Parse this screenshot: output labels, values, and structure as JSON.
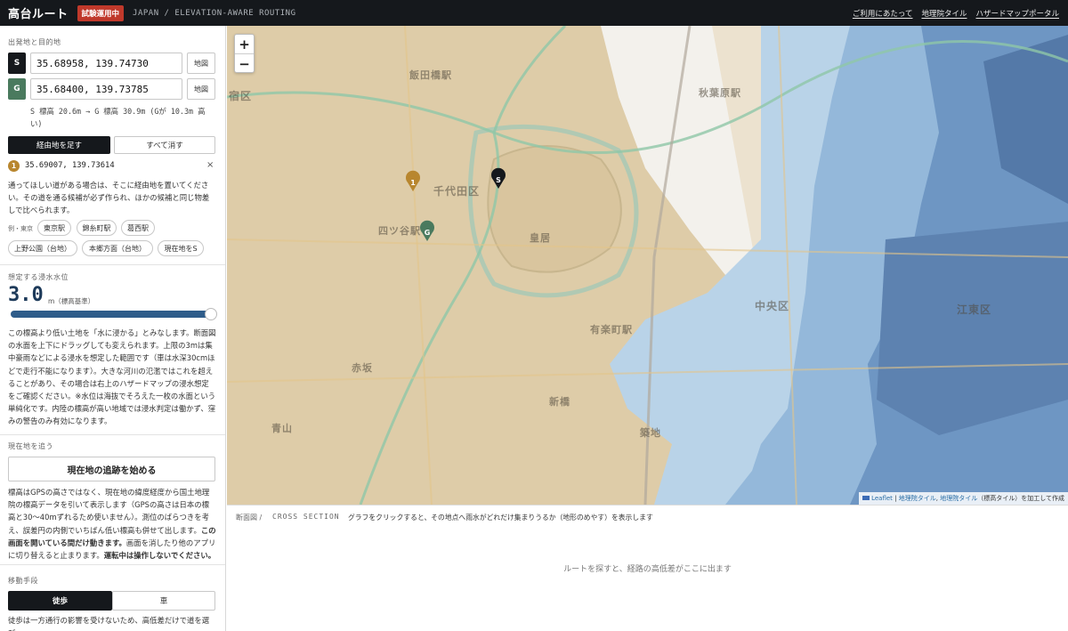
{
  "header": {
    "brand": "高台ルート",
    "badge": "試験運用中",
    "subtitle": "JAPAN / ELEVATION-AWARE ROUTING",
    "links": [
      "ご利用にあたって",
      "地理院タイル",
      "ハザードマップポータル"
    ]
  },
  "route": {
    "heading": "出発地と目的地",
    "start": {
      "pin": "S",
      "value": "35.68958, 139.74730",
      "map_button": "地図"
    },
    "goal": {
      "pin": "G",
      "value": "35.68400, 139.73785",
      "map_button": "地図"
    },
    "elevation_summary": "S 標高 20.6m → G 標高 30.9m (Gが 10.3m 高い)",
    "add_waypoint": "経由地を足す",
    "clear_all": "すべて消す",
    "waypoint": {
      "num": "1",
      "value": "35.69007, 139.73614",
      "remove": "×"
    },
    "hint": "通ってほしい道がある場合は、そこに経由地を置いてください。その道を通る候補が必ず作られ、ほかの候補と同じ物差しで比べられます。",
    "examples_label": "例・東京",
    "examples": [
      "東京駅",
      "錦糸町駅",
      "葛西駅",
      "上野公園（台地）",
      "本郷方面（台地）",
      "現在地をS"
    ]
  },
  "flood": {
    "heading": "想定する浸水水位",
    "value": "3.0",
    "unit": "m（標高基準）",
    "slider_fraction": 0.98,
    "description": "この標高より低い土地を「水に浸かる」とみなします。断面図の水面を上下にドラッグしても変えられます。上限の3mは集中豪雨などによる浸水を想定した範囲です（車は水深30cmほどで走行不能になります）。大きな河川の氾濫ではこれを超えることがあり、その場合は右上のハザードマップの浸水想定をご確認ください。※水位は海抜でそろえた一枚の水面という単純化です。内陸の標高が高い地域では浸水判定は働かず、窪みの警告のみ有効になります。"
  },
  "tracking": {
    "heading": "現在地を追う",
    "button": "現在地の追跡を始める",
    "text1": "標高はGPSの高さではなく、現在地の緯度経度から国土地理院の標高データを引いて表示します（GPSの高さは日本の標高と30〜40mずれるため使いません）。測位のばらつきを考え、誤差円の内側でいちばん低い標高も併せて出します。",
    "text_bold1": "この画面を開いている間だけ動きます。",
    "text2": "画面を消したり他のアプリに切り替えると止まります。",
    "text_bold2": "運転中は操作しないでください。"
  },
  "mode": {
    "heading": "移動手段",
    "walk": "徒歩",
    "car": "車",
    "desc": "徒歩は一方通行の影響を受けないため、高低差だけで道を選び"
  },
  "map": {
    "zoom_in": "+",
    "zoom_out": "−",
    "attribution_leaflet": "Leaflet",
    "attribution_sep": " | ",
    "attribution_tiles": "地理院タイル",
    "attribution_comma": ", ",
    "attribution_elev": "地理院タイル",
    "attribution_rest": "（標高タイル）を加工して作成",
    "place_labels": [
      "飯田橋駅",
      "千代田区",
      "皇居",
      "四ツ谷駅",
      "宿区",
      "秋葉原駅",
      "中央区",
      "江東区",
      "赤坂",
      "新橋",
      "築地",
      "青山",
      "有楽町駅"
    ],
    "marker_start": "S",
    "marker_goal": "G",
    "marker_waypoint": "1",
    "colors": {
      "plateau": "#d8c6a2",
      "low": "#a9c8e2",
      "deep": "#5c86b4",
      "ground": "#f3f1ec"
    }
  },
  "cross_section": {
    "title": "断面図 /",
    "title_en": "CROSS SECTION",
    "hint": "グラフをクリックすると、その地点へ雨水がどれだけ集まりうるか（地形のめやす）を表示します",
    "empty": "ルートを探すと、経路の高低差がここに出ます"
  }
}
